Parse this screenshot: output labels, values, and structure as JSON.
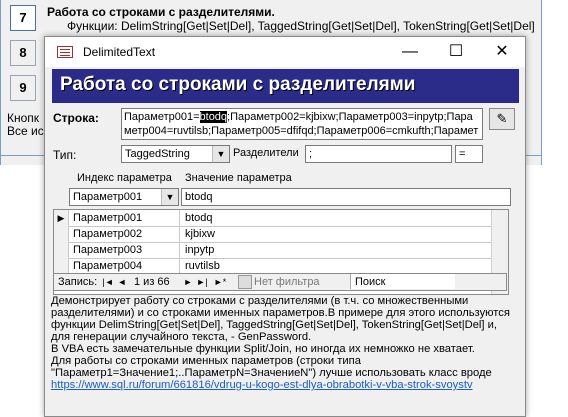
{
  "background": {
    "row7": {
      "number": "7",
      "title": "Работа со строками с разделителями.",
      "functions": "Функции:  DelimString[Get|Set|Del], TaggedString[Get|Set|Del], TokenString[Get|Set|Del]"
    },
    "row8": {
      "number": "8"
    },
    "row9": {
      "number": "9"
    },
    "note1": "Кнопк",
    "note2": "Все ис"
  },
  "window": {
    "title": "DelimitedText",
    "minimize": "—",
    "maximize": "☐",
    "close": "✕"
  },
  "banner": "Работа со строками с разделителями",
  "string": {
    "label": "Строка:",
    "before": "Параметр001=",
    "selected": "btodq",
    "after": ";Параметр002=kjbixw;Параметр003=inpytp;Параметр004=ruvtilsb;Параметр005=dfifqd;Параметр006=cmkufth;Параметр"
  },
  "type": {
    "label": "Тип:",
    "value": "TaggedString"
  },
  "separators": {
    "label": "Разделители",
    "value1": ";",
    "value2": "="
  },
  "subform": {
    "header_index": "Индекс параметра",
    "header_value": "Значение параметра",
    "combo_index": "Параметр001",
    "combo_value": "btodq",
    "rows": [
      {
        "index": "Параметр001",
        "value": "btodq"
      },
      {
        "index": "Параметр002",
        "value": "kjbixw"
      },
      {
        "index": "Параметр003",
        "value": "inpytp"
      },
      {
        "index": "Параметр004",
        "value": "ruvtilsb"
      }
    ]
  },
  "nav": {
    "record_label": "Запись:",
    "first": "|◄",
    "prev": "◄",
    "position": "1 из 66",
    "next": "►",
    "last": "►|",
    "new": "►*",
    "filter": "Нет фильтра",
    "search": "Поиск"
  },
  "description": {
    "lines": [
      "Демонстрирует работу со строками с разделителями (в т.ч. со множественными",
      "разделителями) и со строками именных параметров.В примере для этого используются",
      " функции DelimString[Get|Set|Del], TaggedString[Get|Set|Del], TokenString[Get|Set|Del] и,",
      "для генерации случайного текста, - GenPassword.",
      "В VBA есть замечательные функции Split/Join, но иногда их немножко не хватает.",
      "Для работы со строками именных параметров (строки типа",
      "\"Параметр1=Значение1;..ПараметрN=ЗначениеN\") лучше использовать класс вроде"
    ],
    "link": "https://www.sql.ru/forum/661816/vdrug-u-kogo-est-dlya-obrabotki-v-vba-strok-svoystv"
  }
}
